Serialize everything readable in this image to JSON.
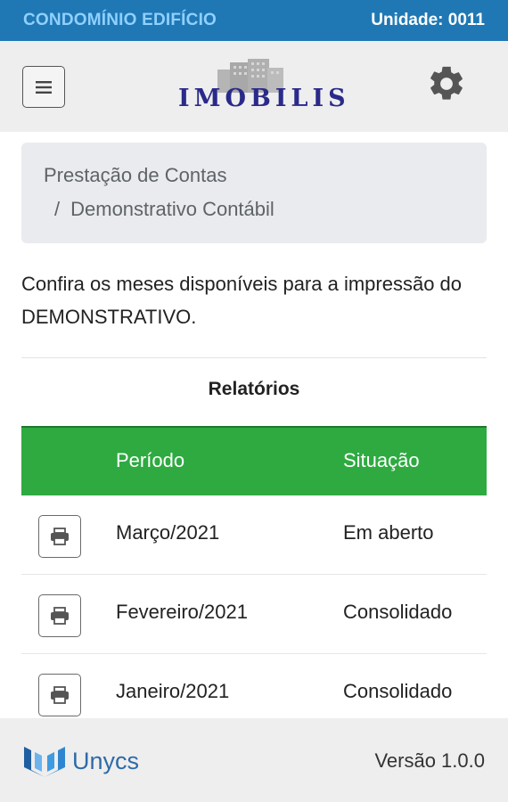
{
  "topbar": {
    "condominium": "CONDOMÍNIO EDIFÍCIO",
    "unit": "Unidade: 0011"
  },
  "header": {
    "logo_text": "IMOBILIS",
    "icons": [
      "menu-icon",
      "gear-icon"
    ]
  },
  "breadcrumb": {
    "parent": "Prestação de Contas",
    "separator": "/",
    "current": "Demonstrativo Contábil"
  },
  "intro": {
    "text": "Confira os meses disponíveis para a impressão do DEMONSTRATIVO."
  },
  "reports": {
    "title": "Relatórios",
    "columns": [
      "Período",
      "Situação"
    ],
    "rows": [
      {
        "period": "Março/2021",
        "status": "Em aberto"
      },
      {
        "period": "Fevereiro/2021",
        "status": "Consolidado"
      },
      {
        "period": "Janeiro/2021",
        "status": "Consolidado"
      }
    ]
  },
  "footer": {
    "brand": "Unycs",
    "version": "Versão 1.0.0"
  },
  "colors": {
    "topbar": "#1f78b4",
    "table_header": "#2eaa41",
    "logo_text": "#2a2a8a"
  }
}
